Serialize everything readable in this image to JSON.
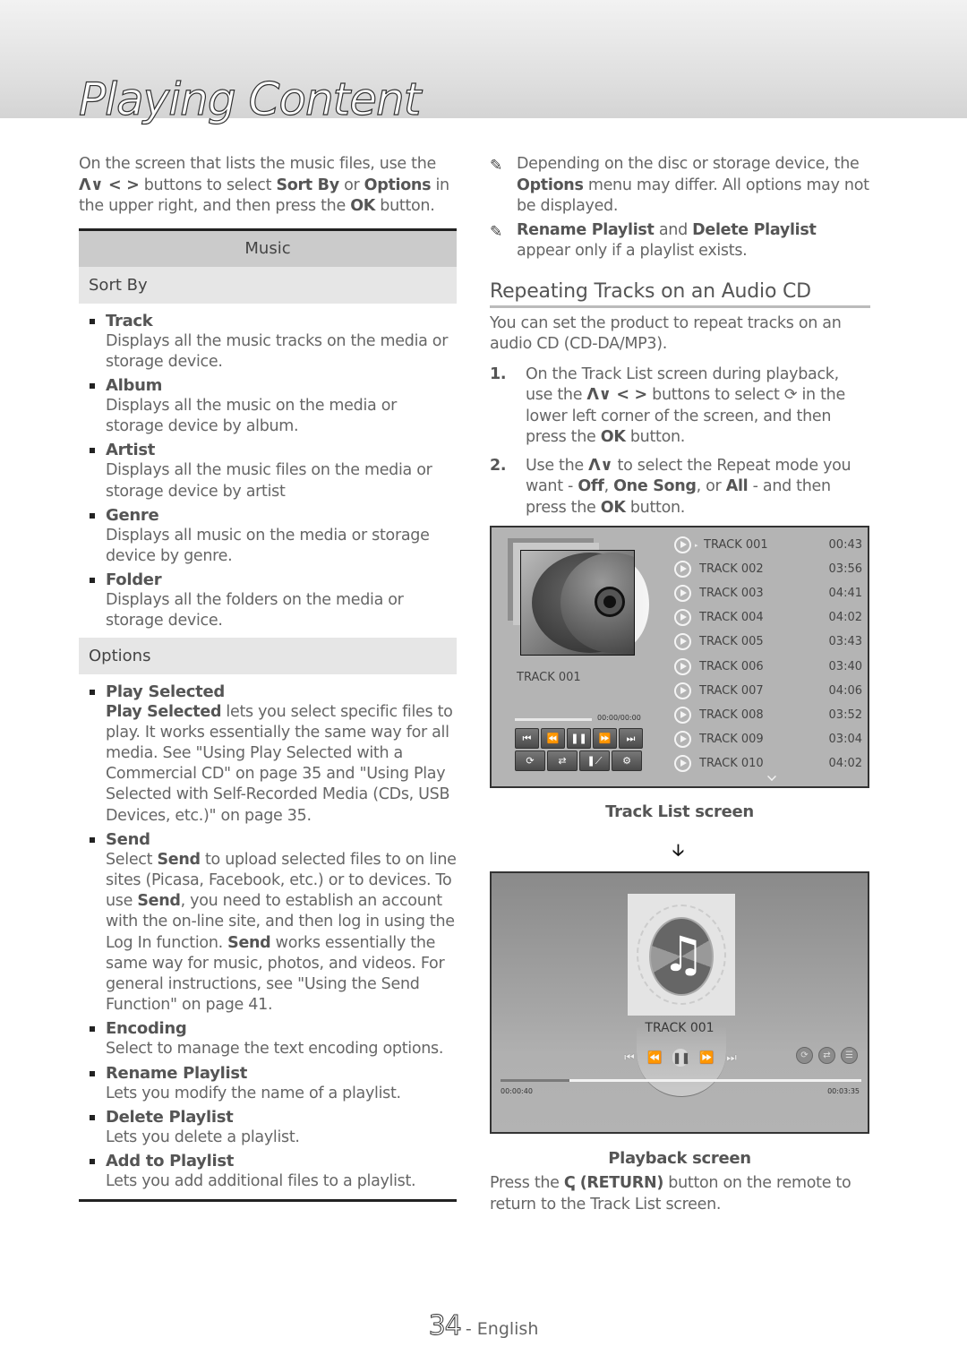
{
  "page_title": "Playing Content",
  "intro": {
    "pre": "On the screen that lists the music files, use the ",
    "arrows": "Λ∨ < >",
    "mid1": " buttons to select ",
    "sort_by": "Sort By",
    "mid2": " or ",
    "options": "Options",
    "mid3": " in the upper right, and then press the ",
    "ok": "OK",
    "post": " button."
  },
  "table": {
    "header": "Music",
    "sort_by": {
      "label": "Sort By",
      "items": [
        {
          "title": "Track",
          "desc": "Displays all the music tracks on the media or storage device."
        },
        {
          "title": "Album",
          "desc": "Displays all the music on the media or storage device by album."
        },
        {
          "title": "Artist",
          "desc": "Displays all the music files on the media or storage device by artist"
        },
        {
          "title": "Genre",
          "desc": "Displays all music on the media or storage device by genre."
        },
        {
          "title": "Folder",
          "desc": "Displays all the folders on the media or storage device."
        }
      ]
    },
    "options": {
      "label": "Options",
      "play_selected": {
        "title": "Play Selected",
        "desc_bold": "Play Selected",
        "desc": " lets you select specific files to play. It works essentially the same way for all media. See \"Using Play Selected with a Commercial CD\" on page 35 and \"Using Play Selected with Self-Recorded Media (CDs, USB Devices, etc.)\" on page 35."
      },
      "send": {
        "title": "Send",
        "d1": "Select ",
        "b1": "Send",
        "d2": " to upload selected files to on line sites (Picasa, Facebook, etc.) or to devices. To use ",
        "b2": "Send",
        "d3": ", you need to establish an account with the on-line site, and then log in using the Log In function. ",
        "b3": "Send",
        "d4": " works essentially the same way for music, photos, and videos. For general instructions, see \"Using the Send Function\" on page 41."
      },
      "items": [
        {
          "title": "Encoding",
          "desc": "Select to manage the text encoding options."
        },
        {
          "title": "Rename Playlist",
          "desc": "Lets you modify the name of a playlist."
        },
        {
          "title": "Delete Playlist",
          "desc": "Lets you delete a playlist."
        },
        {
          "title": "Add to Playlist",
          "desc": "Lets you add additional files to a playlist."
        }
      ]
    }
  },
  "notes": [
    {
      "pre": "Depending on the disc or storage device, the ",
      "b1": "Options",
      "post": " menu may differ. All options may not be displayed."
    },
    {
      "b1": "Rename Playlist",
      "mid": " and ",
      "b2": "Delete Playlist",
      "post": " appear only if a playlist exists."
    }
  ],
  "section": {
    "heading": "Repeating Tracks on an Audio CD",
    "intro": "You can set the product to repeat tracks on an audio CD (CD-DA/MP3).",
    "steps": [
      {
        "num": "1.",
        "pre": "On the Track List screen during playback, use the ",
        "arrows": "Λ∨ < >",
        "mid": " buttons to select ",
        "post": " in the lower left corner of the screen, and then press the ",
        "ok": "OK",
        "end": " button."
      },
      {
        "num": "2.",
        "pre": "Use the ",
        "arrows": "Λ∨",
        "mid": " to select the Repeat mode you want - ",
        "b1": "Off",
        "c1": ", ",
        "b2": "One Song",
        "c2": ", or ",
        "b3": "All",
        "post": " - and then press the ",
        "ok": "OK",
        "end": " button."
      }
    ]
  },
  "track_list_screen": {
    "now_playing": "TRACK 001",
    "time": "00:00/00:00",
    "controls_row1": [
      "⏮",
      "⏪",
      "‖",
      "⏩",
      "⏭"
    ],
    "tracks": [
      {
        "name": "TRACK 001",
        "duration": "00:43",
        "current": true
      },
      {
        "name": "TRACK 002",
        "duration": "03:56"
      },
      {
        "name": "TRACK 003",
        "duration": "04:41"
      },
      {
        "name": "TRACK 004",
        "duration": "04:02"
      },
      {
        "name": "TRACK 005",
        "duration": "03:43"
      },
      {
        "name": "TRACK 006",
        "duration": "03:40"
      },
      {
        "name": "TRACK 007",
        "duration": "04:06"
      },
      {
        "name": "TRACK 008",
        "duration": "03:52"
      },
      {
        "name": "TRACK 009",
        "duration": "03:04"
      },
      {
        "name": "TRACK 010",
        "duration": "04:02"
      }
    ],
    "caption": "Track List screen"
  },
  "playback_screen": {
    "track": "TRACK 001",
    "elapsed": "00:00:40",
    "total": "00:03:35",
    "progress_fraction": 0.19,
    "caption": "Playback screen"
  },
  "return_note": {
    "pre": "Press the ",
    "icon": "ↅ",
    "b1": "(RETURN)",
    "post": " button on the remote to return to the Track List screen."
  },
  "footer": {
    "page_number": "34",
    "language": "- English"
  }
}
